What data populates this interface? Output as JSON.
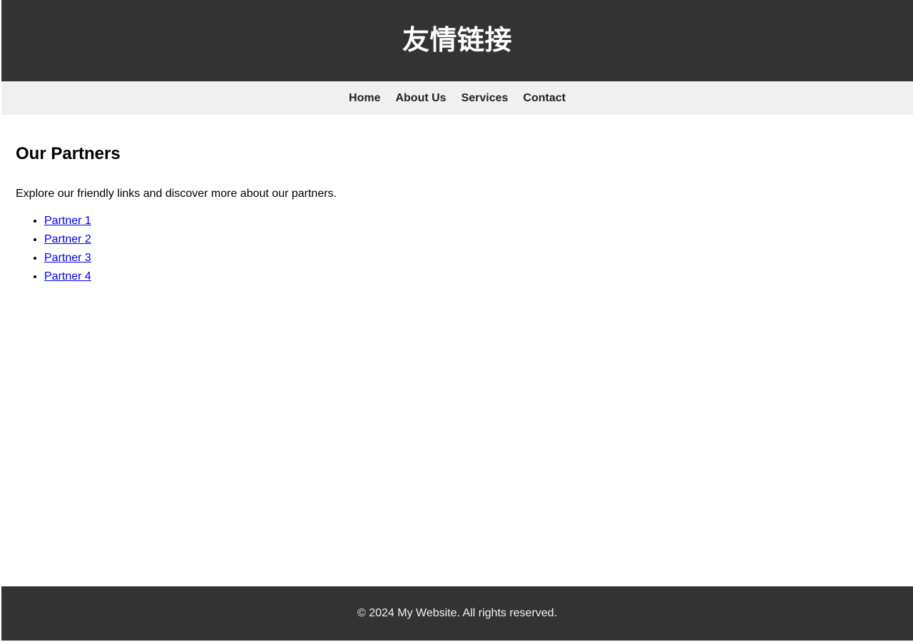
{
  "header": {
    "title": "友情链接",
    "background_color": "#333333",
    "text_color": "#ffffff"
  },
  "nav": {
    "background_color": "#f0f0f0",
    "items": [
      {
        "label": "Home"
      },
      {
        "label": "About Us"
      },
      {
        "label": "Services"
      },
      {
        "label": "Contact"
      }
    ]
  },
  "main": {
    "heading": "Our Partners",
    "description": "Explore our friendly links and discover more about our partners.",
    "partners": [
      {
        "label": "Partner 1"
      },
      {
        "label": "Partner 2"
      },
      {
        "label": "Partner 3"
      },
      {
        "label": "Partner 4"
      }
    ],
    "link_color": "#0000ee"
  },
  "footer": {
    "text": "© 2024 My Website. All rights reserved.",
    "background_color": "#333333",
    "text_color": "#f2f2f2"
  }
}
